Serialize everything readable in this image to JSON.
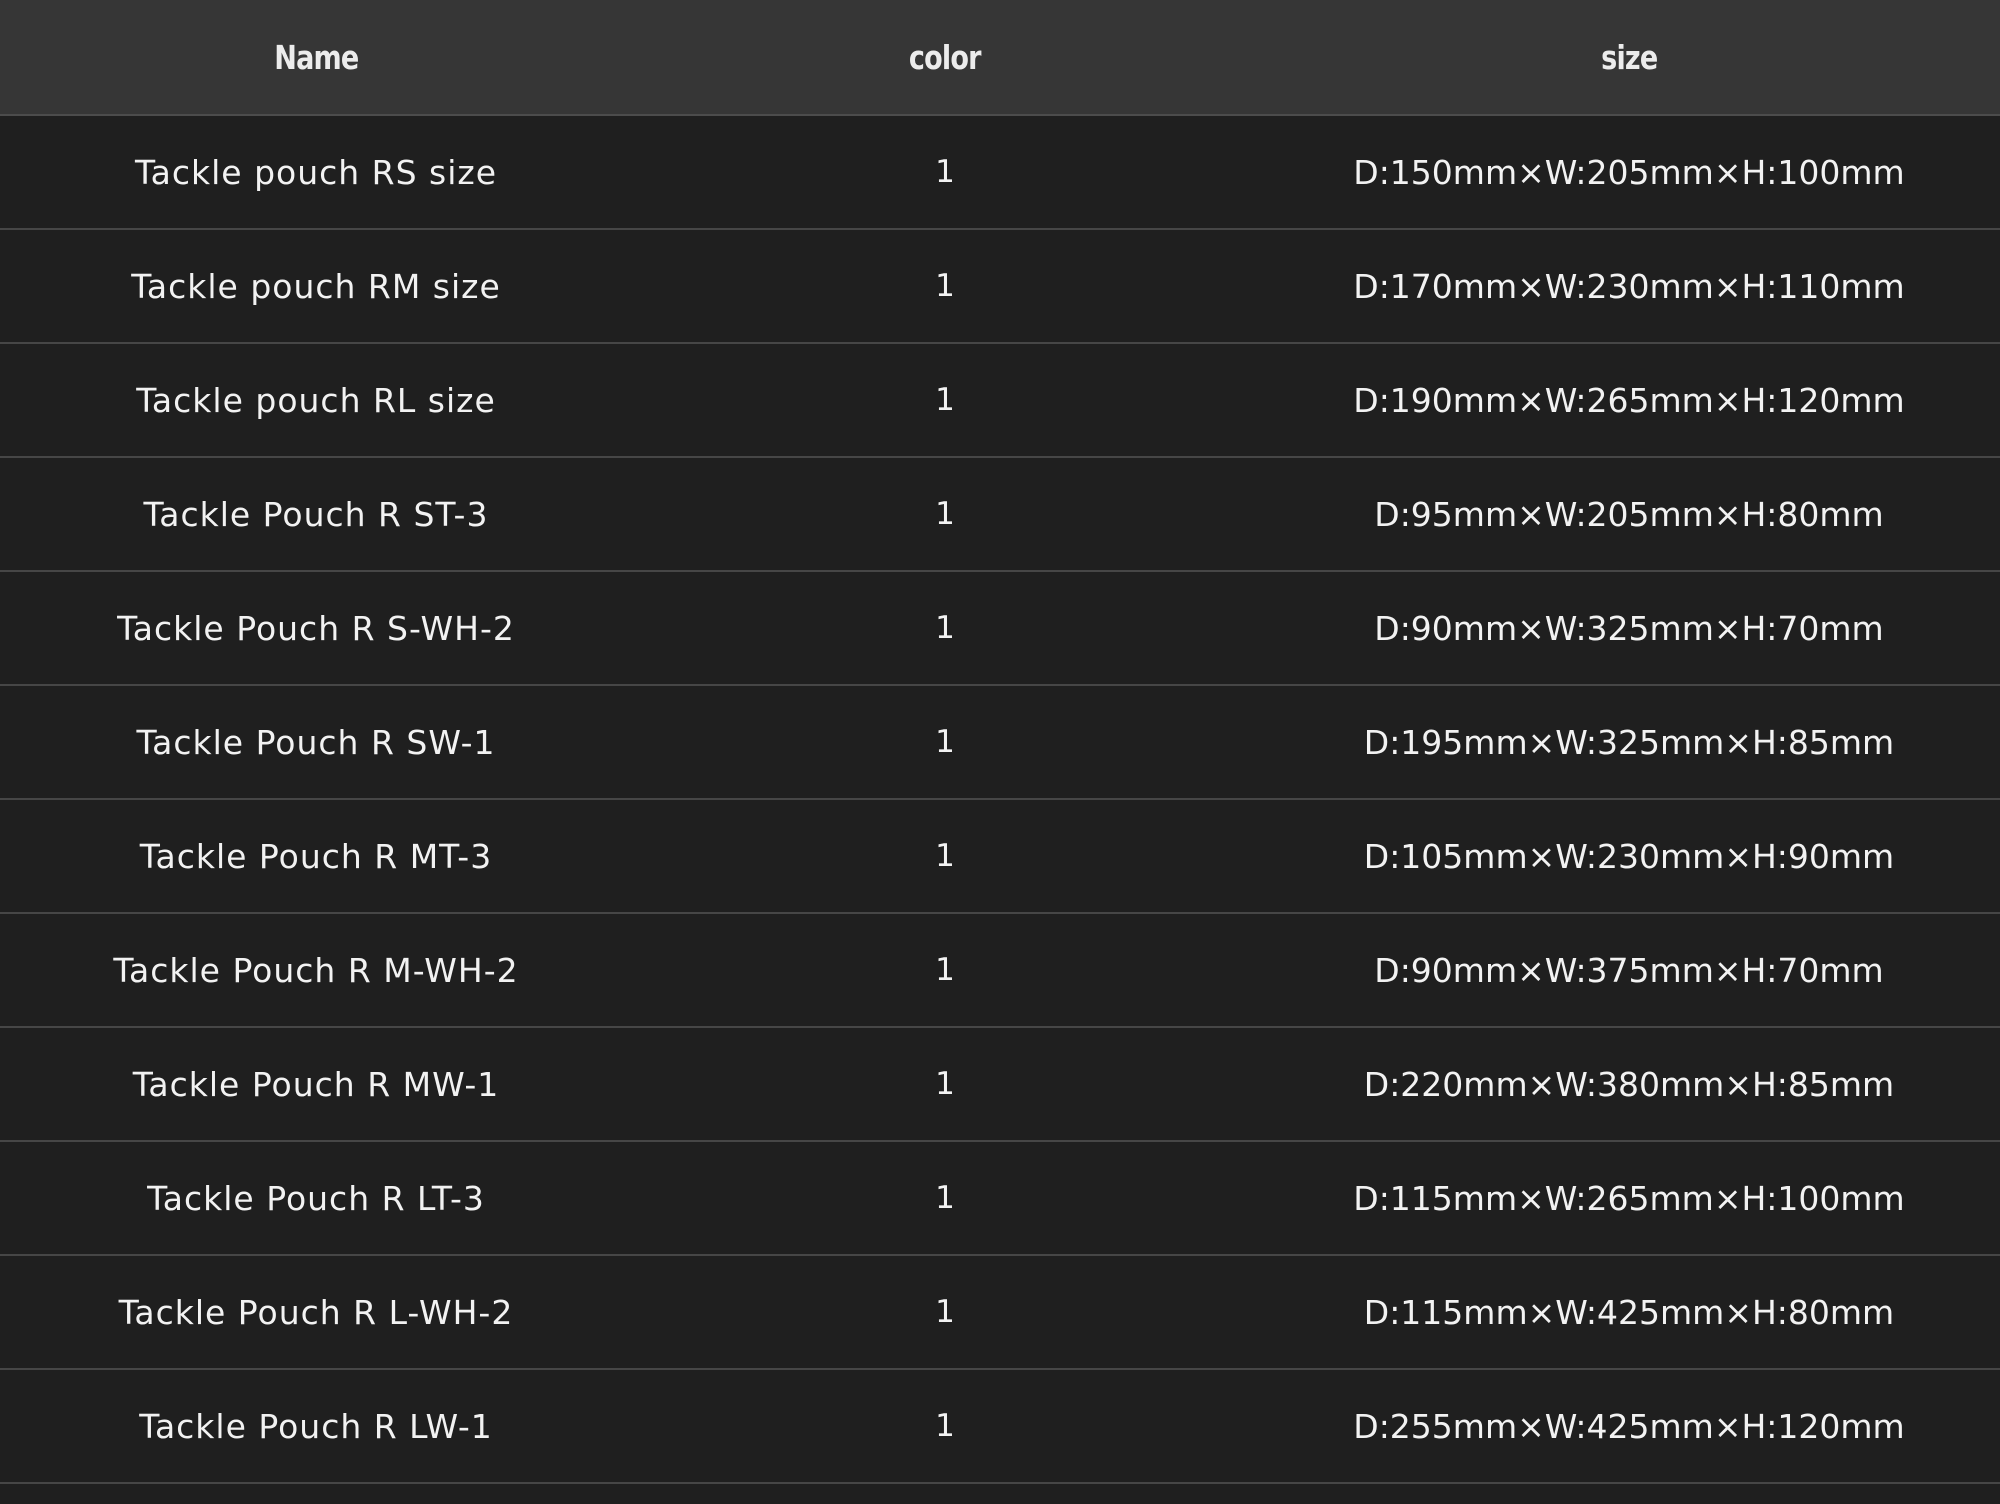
{
  "table": {
    "headers": {
      "name": "Name",
      "color": "color",
      "size": "size"
    },
    "rows": [
      {
        "name": "Tackle pouch RS size",
        "color": "1",
        "size": "D:150mm×W:205mm×H:100mm"
      },
      {
        "name": "Tackle pouch RM size",
        "color": "1",
        "size": "D:170mm×W:230mm×H:110mm"
      },
      {
        "name": "Tackle pouch RL size",
        "color": "1",
        "size": "D:190mm×W:265mm×H:120mm"
      },
      {
        "name": "Tackle Pouch R ST-3",
        "color": "1",
        "size": "D:95mm×W:205mm×H:80mm"
      },
      {
        "name": "Tackle Pouch R S-WH-2",
        "color": "1",
        "size": "D:90mm×W:325mm×H:70mm"
      },
      {
        "name": "Tackle Pouch R SW-1",
        "color": "1",
        "size": "D:195mm×W:325mm×H:85mm"
      },
      {
        "name": "Tackle Pouch R MT-3",
        "color": "1",
        "size": "D:105mm×W:230mm×H:90mm"
      },
      {
        "name": "Tackle Pouch R M-WH-2",
        "color": "1",
        "size": "D:90mm×W:375mm×H:70mm"
      },
      {
        "name": "Tackle Pouch R MW-1",
        "color": "1",
        "size": "D:220mm×W:380mm×H:85mm"
      },
      {
        "name": "Tackle Pouch R LT-3",
        "color": "1",
        "size": "D:115mm×W:265mm×H:100mm"
      },
      {
        "name": "Tackle Pouch R L-WH-2",
        "color": "1",
        "size": "D:115mm×W:425mm×H:80mm"
      },
      {
        "name": "Tackle Pouch R LW-1",
        "color": "1",
        "size": "D:255mm×W:425mm×H:120mm"
      }
    ]
  },
  "colors": {
    "background": "#1f1f1f",
    "header_background": "#363636",
    "text": "#f2f2f2",
    "divider": "#464646"
  }
}
